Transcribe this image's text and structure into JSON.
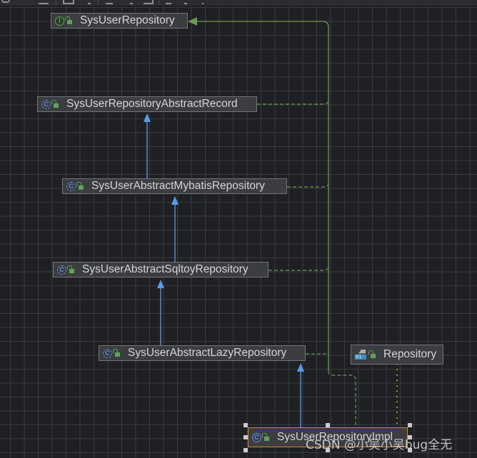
{
  "toolbar": {
    "icons": [
      "refresh-icon",
      "layout-icon",
      "grid-icon",
      "dropdown-icon",
      "export-icon",
      "text-cursor-icon",
      "fit-icon",
      "zoom-icon",
      "settings-icon",
      "pin-icon"
    ]
  },
  "diagram": {
    "type": "uml-class-hierarchy",
    "nodes": [
      {
        "id": "SysUserRepository",
        "label": "SysUserRepository",
        "kind": "interface",
        "visibility": "public"
      },
      {
        "id": "SysUserRepositoryAbstractRecord",
        "label": "SysUserRepositoryAbstractRecord",
        "kind": "abstract-class",
        "visibility": "public"
      },
      {
        "id": "SysUserAbstractMybatisRepository",
        "label": "SysUserAbstractMybatisRepository",
        "kind": "abstract-class",
        "visibility": "public"
      },
      {
        "id": "SysUserAbstractSqltoyRepository",
        "label": "SysUserAbstractSqltoyRepository",
        "kind": "abstract-class",
        "visibility": "public"
      },
      {
        "id": "SysUserAbstractLazyRepository",
        "label": "SysUserAbstractLazyRepository",
        "kind": "abstract-class",
        "visibility": "public"
      },
      {
        "id": "Repository",
        "label": "Repository",
        "kind": "annotation-binary",
        "visibility": "public",
        "binary_label": "01"
      },
      {
        "id": "SysUserRepositoryImpl",
        "label": "SysUserRepositoryImpl",
        "kind": "class",
        "visibility": "public",
        "selected": true
      }
    ],
    "edges": [
      {
        "from": "SysUserRepositoryAbstractRecord",
        "to": "SysUserRepository",
        "type": "implements"
      },
      {
        "from": "SysUserAbstractMybatisRepository",
        "to": "SysUserRepository",
        "type": "implements"
      },
      {
        "from": "SysUserAbstractSqltoyRepository",
        "to": "SysUserRepository",
        "type": "implements"
      },
      {
        "from": "SysUserAbstractLazyRepository",
        "to": "SysUserRepository",
        "type": "implements"
      },
      {
        "from": "SysUserRepositoryImpl",
        "to": "SysUserRepository",
        "type": "implements"
      },
      {
        "from": "SysUserAbstractMybatisRepository",
        "to": "SysUserRepositoryAbstractRecord",
        "type": "extends"
      },
      {
        "from": "SysUserAbstractSqltoyRepository",
        "to": "SysUserAbstractMybatisRepository",
        "type": "extends"
      },
      {
        "from": "SysUserAbstractLazyRepository",
        "to": "SysUserAbstractSqltoyRepository",
        "type": "extends"
      },
      {
        "from": "SysUserRepositoryImpl",
        "to": "SysUserAbstractLazyRepository",
        "type": "extends"
      },
      {
        "from": "SysUserRepositoryImpl",
        "to": "Repository",
        "type": "annotated-by"
      }
    ],
    "colors": {
      "extends": "#5a9bea",
      "implements": "#6a9a55",
      "annotated": "#b8b81e",
      "selection": "#d08a2a"
    },
    "icon_letters": {
      "class": "C",
      "interface": "I"
    }
  },
  "watermark": "CSDN @小吴小吴bug全无"
}
